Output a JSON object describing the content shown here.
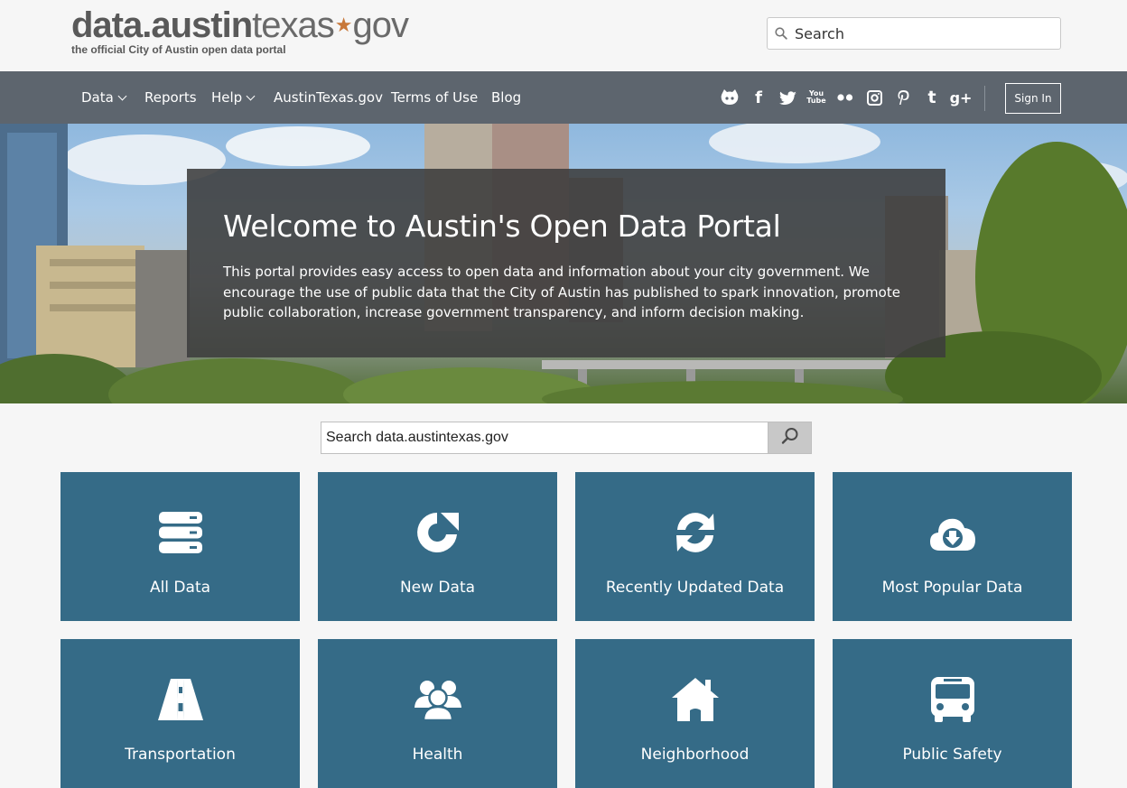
{
  "header": {
    "logo_bold": "data.austin",
    "logo_light": "texas",
    "logo_star": "★",
    "logo_gov": "gov",
    "logo_tagline": "the official City of Austin open data portal",
    "search_placeholder": "Search"
  },
  "nav": {
    "items": [
      {
        "label": "Data",
        "dropdown": true
      },
      {
        "label": "Reports",
        "dropdown": false
      },
      {
        "label": "Help",
        "dropdown": true
      },
      {
        "label": "AustinTexas.gov",
        "dropdown": false
      },
      {
        "label": "Terms of Use",
        "dropdown": false
      },
      {
        "label": "Blog",
        "dropdown": false
      }
    ],
    "social": [
      "github-icon",
      "facebook-icon",
      "twitter-icon",
      "youtube-icon",
      "flickr-icon",
      "instagram-icon",
      "pinterest-icon",
      "tumblr-icon",
      "google-plus-icon"
    ],
    "social_text": {
      "facebook": "f",
      "youtube": "You\nTube",
      "tumblr": "t",
      "gplus": "g+"
    },
    "sign_in": "Sign In"
  },
  "hero": {
    "title": "Welcome to Austin's Open Data Portal",
    "text": "This portal provides easy access to open data and information about your city government. We encourage the use of public data that the City of Austin has published to spark innovation, promote public collaboration, increase government transparency, and inform decision making."
  },
  "main_search": {
    "placeholder": "Search data.austintexas.gov"
  },
  "tiles": [
    {
      "label": "All Data",
      "icon": "database-icon"
    },
    {
      "label": "New Data",
      "icon": "refresh-new-icon"
    },
    {
      "label": "Recently Updated Data",
      "icon": "sync-icon"
    },
    {
      "label": "Most Popular Data",
      "icon": "cloud-download-icon"
    },
    {
      "label": "Transportation",
      "icon": "road-icon"
    },
    {
      "label": "Health",
      "icon": "people-icon"
    },
    {
      "label": "Neighborhood",
      "icon": "house-icon"
    },
    {
      "label": "Public Safety",
      "icon": "bus-icon"
    }
  ],
  "colors": {
    "nav_bg": "#5d656e",
    "tile_bg": "#356b87",
    "page_bg": "#f6f6f6",
    "accent_star": "#c8783a"
  }
}
